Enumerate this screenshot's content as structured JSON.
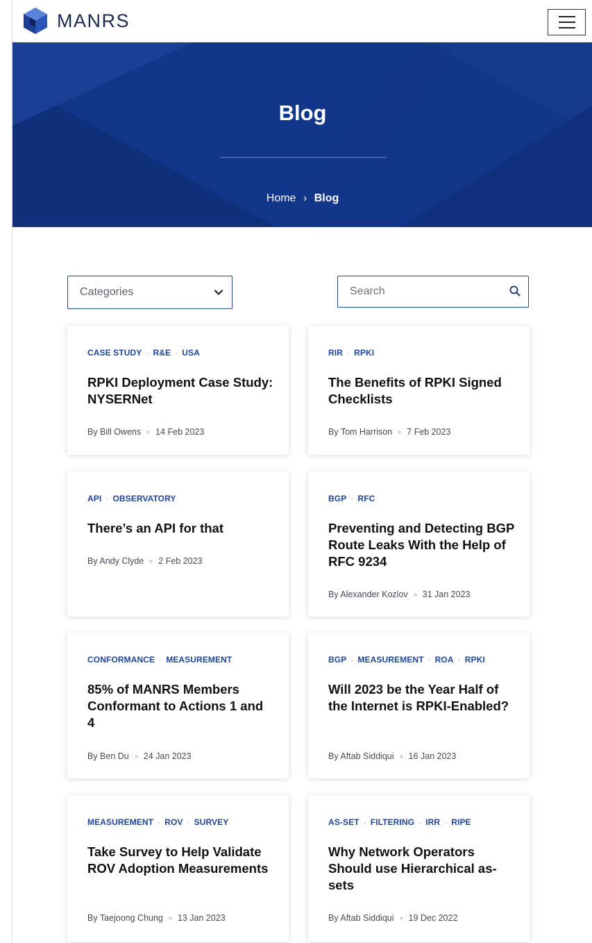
{
  "header": {
    "brand": "MANRS",
    "menu_icon": "hamburger-icon"
  },
  "hero": {
    "title": "Blog",
    "breadcrumb": {
      "home": "Home",
      "separator": "›",
      "current": "Blog"
    }
  },
  "filters": {
    "categories_label": "Categories",
    "search_placeholder": "Search"
  },
  "colors": {
    "hero_bg": "#12368a",
    "tag": "#1f4597",
    "border": "#23458f"
  },
  "posts": [
    {
      "tags": [
        "CASE STUDY",
        "R&E",
        "USA"
      ],
      "title": "RPKI Deployment Case Study: NYSERNet",
      "author": "By Bill Owens",
      "date": "14 Feb 2023"
    },
    {
      "tags": [
        "RIR",
        "RPKI"
      ],
      "title": "The Benefits of RPKI Signed Checklists",
      "author": "By Tom Harrison",
      "date": "7 Feb 2023"
    },
    {
      "tags": [
        "API",
        "OBSERVATORY"
      ],
      "title": "There’s an API for that",
      "author": "By Andy Clyde",
      "date": "2 Feb 2023"
    },
    {
      "tags": [
        "BGP",
        "RFC"
      ],
      "title": "Preventing and Detecting BGP Route Leaks With the Help of RFC 9234",
      "author": "By Alexander Kozlov",
      "date": "31 Jan 2023"
    },
    {
      "tags": [
        "CONFORMANCE",
        "MEASUREMENT"
      ],
      "title": "85% of MANRS Members Conformant to Actions 1 and 4",
      "author": "By Ben Du",
      "date": "24 Jan 2023"
    },
    {
      "tags": [
        "BGP",
        "MEASUREMENT",
        "ROA",
        "RPKI"
      ],
      "title": "Will 2023 be the Year Half of the Internet is RPKI-Enabled?",
      "author": "By Aftab Siddiqui",
      "date": "16 Jan 2023"
    },
    {
      "tags": [
        "MEASUREMENT",
        "ROV",
        "SURVEY"
      ],
      "title": "Take Survey to Help Validate ROV Adoption Measurements",
      "author": "By Taejoong Chung",
      "date": "13 Jan 2023"
    },
    {
      "tags": [
        "AS-SET",
        "FILTERING",
        "IRR",
        "RIPE"
      ],
      "title": "Why Network Operators Should use Hierarchical as-sets",
      "author": "By Aftab Siddiqui",
      "date": "19 Dec 2022"
    }
  ]
}
